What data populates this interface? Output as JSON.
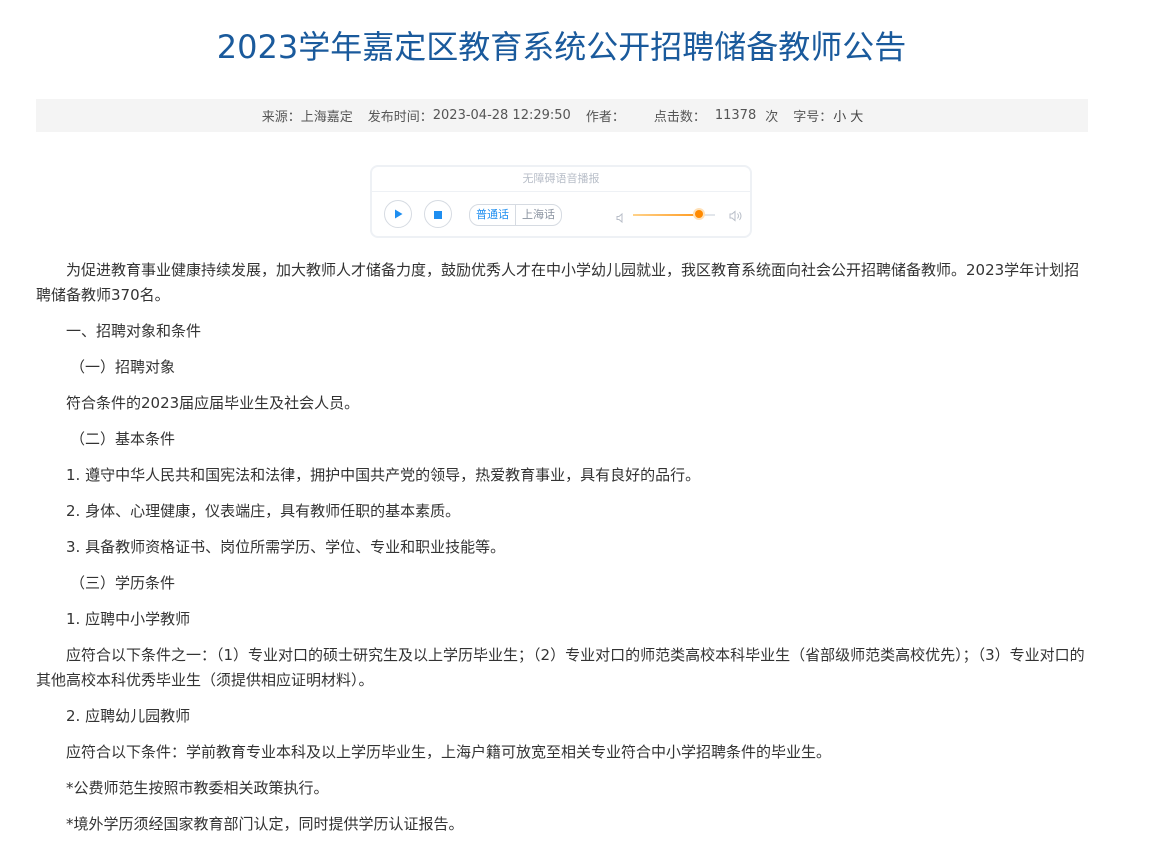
{
  "title": "2023学年嘉定区教育系统公开招聘储备教师公告",
  "meta": {
    "source_label": "来源：",
    "source": "上海嘉定",
    "date_label": "发布时间：",
    "date": "2023-04-28 12:29:50",
    "author_label": "作者：",
    "author": "",
    "views_label": "点击数：",
    "views": "11378",
    "views_unit": "次",
    "fontsize_label": "字号：",
    "font_small": "小",
    "font_large": "大"
  },
  "player": {
    "header": "无障碍语音播报",
    "lang_mandarin": "普通话",
    "lang_shanghai": "上海话",
    "volume_level": 0.8,
    "accent_color": "#1e8ef0",
    "volume_color": "#ff8a00"
  },
  "article": {
    "intro": "为促进教育事业健康持续发展，加大教师人才储备力度，鼓励优秀人才在中小学幼儿园就业，我区教育系统面向社会公开招聘储备教师。2023学年计划招聘储备教师370名。",
    "s1": "一、招聘对象和条件",
    "s1_1": "（一）招聘对象",
    "s1_1_text": "符合条件的2023届应届毕业生及社会人员。",
    "s1_2": "（二）基本条件",
    "s1_2_a": "1. 遵守中华人民共和国宪法和法律，拥护中国共产党的领导，热爱教育事业，具有良好的品行。",
    "s1_2_b": "2. 身体、心理健康，仪表端庄，具有教师任职的基本素质。",
    "s1_2_c": "3. 具备教师资格证书、岗位所需学历、学位、专业和职业技能等。",
    "s1_3": "（三）学历条件",
    "s1_3_a": "1. 应聘中小学教师",
    "s1_3_a_text": "应符合以下条件之一：（1）专业对口的硕士研究生及以上学历毕业生；（2）专业对口的师范类高校本科毕业生（省部级师范类高校优先）；（3）专业对口的其他高校本科优秀毕业生（须提供相应证明材料）。",
    "s1_3_b": "2. 应聘幼儿园教师",
    "s1_3_b_text": "应符合以下条件：学前教育专业本科及以上学历毕业生，上海户籍可放宽至相关专业符合中小学招聘条件的毕业生。",
    "note1": "*公费师范生按照市教委相关政策执行。",
    "note2": "*境外学历须经国家教育部门认定，同时提供学历认证报告。"
  }
}
